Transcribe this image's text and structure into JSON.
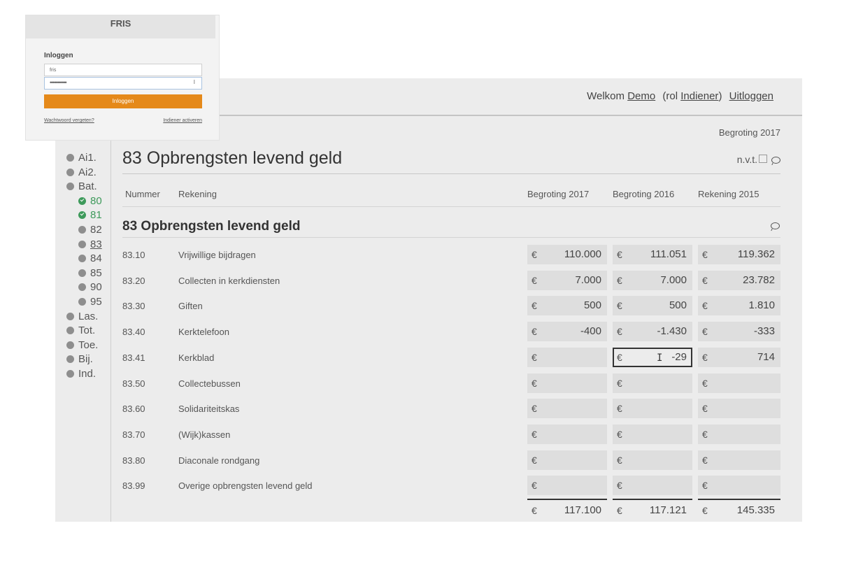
{
  "header": {
    "welcome_prefix": "Welkom",
    "user": "Demo",
    "role_prefix": "(rol",
    "role": "Indiener",
    "role_suffix": ")",
    "logout": "Uitloggen"
  },
  "sidebar": {
    "items": [
      {
        "label": "Ai1.",
        "level": 1,
        "status": "open"
      },
      {
        "label": "Ai2.",
        "level": 1,
        "status": "open"
      },
      {
        "label": "Bat.",
        "level": 1,
        "status": "open"
      },
      {
        "label": "80",
        "level": 2,
        "status": "done"
      },
      {
        "label": "81",
        "level": 2,
        "status": "done"
      },
      {
        "label": "82",
        "level": 2,
        "status": "open"
      },
      {
        "label": "83",
        "level": 2,
        "status": "current"
      },
      {
        "label": "84",
        "level": 2,
        "status": "open"
      },
      {
        "label": "85",
        "level": 2,
        "status": "open"
      },
      {
        "label": "90",
        "level": 2,
        "status": "open"
      },
      {
        "label": "95",
        "level": 2,
        "status": "open"
      },
      {
        "label": "Las.",
        "level": 1,
        "status": "open"
      },
      {
        "label": "Tot.",
        "level": 1,
        "status": "open"
      },
      {
        "label": "Toe.",
        "level": 1,
        "status": "open"
      },
      {
        "label": "Bij.",
        "level": 1,
        "status": "open"
      },
      {
        "label": "Ind.",
        "level": 1,
        "status": "open"
      }
    ]
  },
  "main": {
    "budget_label": "Begroting 2017",
    "title": "83 Opbrengsten levend geld",
    "nvt_label": "n.v.t.",
    "columns": [
      "Nummer",
      "Rekening",
      "Begroting 2017",
      "Begroting 2016",
      "Rekening 2015"
    ],
    "section_title": "83 Opbrengsten levend geld",
    "currency": "€",
    "rows": [
      {
        "number": "83.10",
        "account": "Vrijwillige bijdragen",
        "b2017": "110.000",
        "b2016": "111.051",
        "r2015": "119.362"
      },
      {
        "number": "83.20",
        "account": "Collecten in kerkdiensten",
        "b2017": "7.000",
        "b2016": "7.000",
        "r2015": "23.782"
      },
      {
        "number": "83.30",
        "account": "Giften",
        "b2017": "500",
        "b2016": "500",
        "r2015": "1.810"
      },
      {
        "number": "83.40",
        "account": "Kerktelefoon",
        "b2017": "-400",
        "b2016": "-1.430",
        "r2015": "-333"
      },
      {
        "number": "83.41",
        "account": "Kerkblad",
        "b2017": "",
        "b2016": "-29",
        "r2015": "714"
      },
      {
        "number": "83.50",
        "account": "Collectebussen",
        "b2017": "",
        "b2016": "",
        "r2015": ""
      },
      {
        "number": "83.60",
        "account": "Solidariteitskas",
        "b2017": "",
        "b2016": "",
        "r2015": ""
      },
      {
        "number": "83.70",
        "account": "(Wijk)kassen",
        "b2017": "",
        "b2016": "",
        "r2015": ""
      },
      {
        "number": "83.80",
        "account": "Diaconale rondgang",
        "b2017": "",
        "b2016": "",
        "r2015": ""
      },
      {
        "number": "83.99",
        "account": "Overige opbrengsten levend geld",
        "b2017": "",
        "b2016": "",
        "r2015": ""
      }
    ],
    "totals": {
      "b2017": "117.100",
      "b2016": "117.121",
      "r2015": "145.335"
    },
    "active_cell": {
      "row": 4,
      "column": "b2016"
    }
  },
  "login": {
    "title": "FRIS",
    "heading": "Inloggen",
    "username": "fris",
    "password_mask": "•••••••••••",
    "button": "Inloggen",
    "forgot_link": "Wachtwoord vergeten?",
    "activate_link": "Indiener activeren"
  },
  "colors": {
    "accent": "#e5891a",
    "done": "#3e9a5b",
    "panel": "#ececec"
  }
}
